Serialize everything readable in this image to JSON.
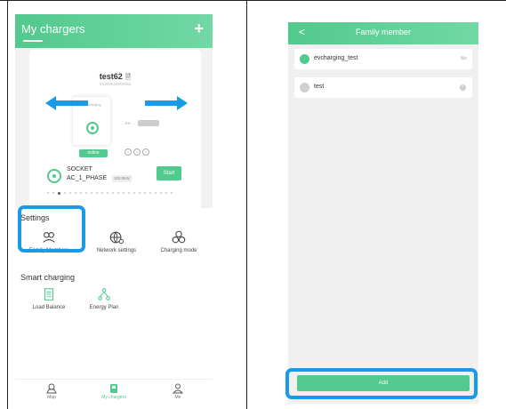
{
  "left_app": {
    "header": {
      "title": "My chargers",
      "add_symbol": "+"
    },
    "charger": {
      "name": "test62",
      "serial": "SS200624000062",
      "device_brand": "evcharging",
      "cable_label": "- - RD - -",
      "cable_box": "",
      "status": "online",
      "socket_line1": "SOCKET",
      "socket_line2": "AC_1_PHASE",
      "power": "100.0kW",
      "start_label": "Start"
    },
    "settings": {
      "title": "Settings",
      "items": [
        {
          "label": "Family Members",
          "icon": "family-members-icon"
        },
        {
          "label": "Network settings",
          "icon": "network-settings-icon"
        },
        {
          "label": "Charging mode",
          "icon": "charging-mode-icon"
        }
      ]
    },
    "smart_charging": {
      "title": "Smart charging",
      "items": [
        {
          "label": "Load Balance",
          "icon": "load-balance-icon"
        },
        {
          "label": "Energy Plan",
          "icon": "energy-plan-icon"
        }
      ]
    },
    "tabs": [
      {
        "label": "Map",
        "icon": "map-icon"
      },
      {
        "label": "My chargers",
        "icon": "charger-icon",
        "active": true
      },
      {
        "label": "Me",
        "icon": "person-icon"
      }
    ]
  },
  "right_app": {
    "header": {
      "back_symbol": "<",
      "title": "Family member"
    },
    "members": [
      {
        "name": "evcharging_test",
        "tag": "Me"
      },
      {
        "name": "test",
        "tag": ""
      }
    ],
    "add_label": "Add"
  },
  "colors": {
    "accent": "#52c98d",
    "highlight": "#1a9be8",
    "arrow": "#1a9be8"
  }
}
